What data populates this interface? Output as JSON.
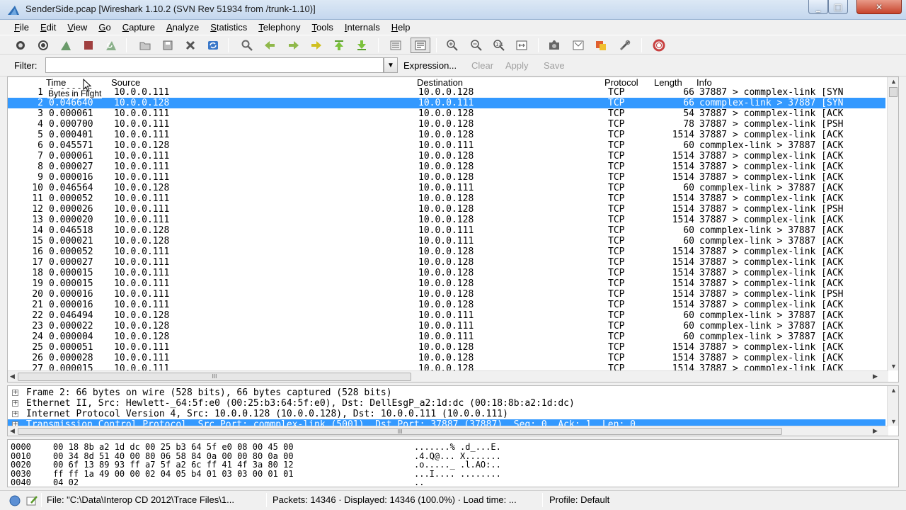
{
  "window": {
    "title": "SenderSide.pcap   [Wireshark 1.10.2  (SVN Rev 51934 from /trunk-1.10)]"
  },
  "menu": [
    "File",
    "Edit",
    "View",
    "Go",
    "Capture",
    "Analyze",
    "Statistics",
    "Telephony",
    "Tools",
    "Internals",
    "Help"
  ],
  "toolbar_icons": [
    "interface-list-icon",
    "capture-options-icon",
    "start-capture-icon",
    "stop-capture-icon",
    "restart-capture-icon",
    "open-file-icon",
    "save-file-icon",
    "close-file-icon",
    "reload-icon",
    "find-packet-icon",
    "go-back-icon",
    "go-forward-icon",
    "go-to-packet-icon",
    "go-first-icon",
    "go-last-icon",
    "colorize-icon",
    "auto-scroll-icon",
    "zoom-in-icon",
    "zoom-out-icon",
    "normal-size-icon",
    "resize-columns-icon",
    "capture-filters-icon",
    "display-filters-icon",
    "coloring-rules-icon",
    "preferences-icon",
    "help-icon"
  ],
  "filter": {
    "label": "Filter:",
    "value": "",
    "expression": "Expression...",
    "clear": "Clear",
    "apply": "Apply",
    "save": "Save"
  },
  "packet_list": {
    "columns": {
      "time": "Time",
      "source": "Source",
      "destination": "Destination",
      "protocol": "Protocol",
      "length": "Length",
      "info": "Info"
    },
    "tooltip": "Bytes in Flight",
    "selected_index": 1,
    "rows": [
      {
        "no": "1",
        "time": "0.000000",
        "src": "10.0.0.111",
        "dst": "10.0.0.128",
        "proto": "TCP",
        "len": "66",
        "info": "37887 > commplex-link [SYN"
      },
      {
        "no": "2",
        "time": "0.046640",
        "src": "10.0.0.128",
        "dst": "10.0.0.111",
        "proto": "TCP",
        "len": "66",
        "info": "commplex-link > 37887 [SYN"
      },
      {
        "no": "3",
        "time": "0.000061",
        "src": "10.0.0.111",
        "dst": "10.0.0.128",
        "proto": "TCP",
        "len": "54",
        "info": "37887 > commplex-link [ACK"
      },
      {
        "no": "4",
        "time": "0.000700",
        "src": "10.0.0.111",
        "dst": "10.0.0.128",
        "proto": "TCP",
        "len": "78",
        "info": "37887 > commplex-link [PSH"
      },
      {
        "no": "5",
        "time": "0.000401",
        "src": "10.0.0.111",
        "dst": "10.0.0.128",
        "proto": "TCP",
        "len": "1514",
        "info": "37887 > commplex-link [ACK"
      },
      {
        "no": "6",
        "time": "0.045571",
        "src": "10.0.0.128",
        "dst": "10.0.0.111",
        "proto": "TCP",
        "len": "60",
        "info": "commplex-link > 37887 [ACK"
      },
      {
        "no": "7",
        "time": "0.000061",
        "src": "10.0.0.111",
        "dst": "10.0.0.128",
        "proto": "TCP",
        "len": "1514",
        "info": "37887 > commplex-link [ACK"
      },
      {
        "no": "8",
        "time": "0.000027",
        "src": "10.0.0.111",
        "dst": "10.0.0.128",
        "proto": "TCP",
        "len": "1514",
        "info": "37887 > commplex-link [ACK"
      },
      {
        "no": "9",
        "time": "0.000016",
        "src": "10.0.0.111",
        "dst": "10.0.0.128",
        "proto": "TCP",
        "len": "1514",
        "info": "37887 > commplex-link [ACK"
      },
      {
        "no": "10",
        "time": "0.046564",
        "src": "10.0.0.128",
        "dst": "10.0.0.111",
        "proto": "TCP",
        "len": "60",
        "info": "commplex-link > 37887 [ACK"
      },
      {
        "no": "11",
        "time": "0.000052",
        "src": "10.0.0.111",
        "dst": "10.0.0.128",
        "proto": "TCP",
        "len": "1514",
        "info": "37887 > commplex-link [ACK"
      },
      {
        "no": "12",
        "time": "0.000026",
        "src": "10.0.0.111",
        "dst": "10.0.0.128",
        "proto": "TCP",
        "len": "1514",
        "info": "37887 > commplex-link [PSH"
      },
      {
        "no": "13",
        "time": "0.000020",
        "src": "10.0.0.111",
        "dst": "10.0.0.128",
        "proto": "TCP",
        "len": "1514",
        "info": "37887 > commplex-link [ACK"
      },
      {
        "no": "14",
        "time": "0.046518",
        "src": "10.0.0.128",
        "dst": "10.0.0.111",
        "proto": "TCP",
        "len": "60",
        "info": "commplex-link > 37887 [ACK"
      },
      {
        "no": "15",
        "time": "0.000021",
        "src": "10.0.0.128",
        "dst": "10.0.0.111",
        "proto": "TCP",
        "len": "60",
        "info": "commplex-link > 37887 [ACK"
      },
      {
        "no": "16",
        "time": "0.000052",
        "src": "10.0.0.111",
        "dst": "10.0.0.128",
        "proto": "TCP",
        "len": "1514",
        "info": "37887 > commplex-link [ACK"
      },
      {
        "no": "17",
        "time": "0.000027",
        "src": "10.0.0.111",
        "dst": "10.0.0.128",
        "proto": "TCP",
        "len": "1514",
        "info": "37887 > commplex-link [ACK"
      },
      {
        "no": "18",
        "time": "0.000015",
        "src": "10.0.0.111",
        "dst": "10.0.0.128",
        "proto": "TCP",
        "len": "1514",
        "info": "37887 > commplex-link [ACK"
      },
      {
        "no": "19",
        "time": "0.000015",
        "src": "10.0.0.111",
        "dst": "10.0.0.128",
        "proto": "TCP",
        "len": "1514",
        "info": "37887 > commplex-link [ACK"
      },
      {
        "no": "20",
        "time": "0.000016",
        "src": "10.0.0.111",
        "dst": "10.0.0.128",
        "proto": "TCP",
        "len": "1514",
        "info": "37887 > commplex-link [PSH"
      },
      {
        "no": "21",
        "time": "0.000016",
        "src": "10.0.0.111",
        "dst": "10.0.0.128",
        "proto": "TCP",
        "len": "1514",
        "info": "37887 > commplex-link [ACK"
      },
      {
        "no": "22",
        "time": "0.046494",
        "src": "10.0.0.128",
        "dst": "10.0.0.111",
        "proto": "TCP",
        "len": "60",
        "info": "commplex-link > 37887 [ACK"
      },
      {
        "no": "23",
        "time": "0.000022",
        "src": "10.0.0.128",
        "dst": "10.0.0.111",
        "proto": "TCP",
        "len": "60",
        "info": "commplex-link > 37887 [ACK"
      },
      {
        "no": "24",
        "time": "0.000004",
        "src": "10.0.0.128",
        "dst": "10.0.0.111",
        "proto": "TCP",
        "len": "60",
        "info": "commplex-link > 37887 [ACK"
      },
      {
        "no": "25",
        "time": "0.000051",
        "src": "10.0.0.111",
        "dst": "10.0.0.128",
        "proto": "TCP",
        "len": "1514",
        "info": "37887 > commplex-link [ACK"
      },
      {
        "no": "26",
        "time": "0.000028",
        "src": "10.0.0.111",
        "dst": "10.0.0.128",
        "proto": "TCP",
        "len": "1514",
        "info": "37887 > commplex-link [ACK"
      },
      {
        "no": "27",
        "time": "0.000015",
        "src": "10.0.0.111",
        "dst": "10.0.0.128",
        "proto": "TCP",
        "len": "1514",
        "info": "37887 > commplex-link [ACK"
      }
    ]
  },
  "details": [
    {
      "text": "Frame 2: 66 bytes on wire (528 bits), 66 bytes captured (528 bits)",
      "selected": false
    },
    {
      "text": "Ethernet II, Src: Hewlett-_64:5f:e0 (00:25:b3:64:5f:e0), Dst: DellEsgP_a2:1d:dc (00:18:8b:a2:1d:dc)",
      "selected": false
    },
    {
      "text": "Internet Protocol Version 4, Src: 10.0.0.128 (10.0.0.128), Dst: 10.0.0.111 (10.0.0.111)",
      "selected": false
    },
    {
      "text": "Transmission Control Protocol, Src Port: commplex-link (5001), Dst Port: 37887 (37887), Seq: 0, Ack: 1, Len: 0",
      "selected": true
    }
  ],
  "bytes": [
    {
      "offset": "0000",
      "hex": "00 18 8b a2 1d dc 00 25  b3 64 5f e0 08 00 45 00",
      "ascii": ".......% .d_...E."
    },
    {
      "offset": "0010",
      "hex": "00 34 8d 51 40 00 80 06  58 84 0a 00 00 80 0a 00",
      "ascii": ".4.Q@... X......."
    },
    {
      "offset": "0020",
      "hex": "00 6f 13 89 93 ff a7 5f  a2 6c ff 41 4f 3a 80 12",
      "ascii": ".o....._ .l.AO:.."
    },
    {
      "offset": "0030",
      "hex": "ff ff 1a 49 00 00 02 04  05 b4 01 03 03 00 01 01",
      "ascii": "...I.... ........"
    },
    {
      "offset": "0040",
      "hex": "04 02",
      "ascii": ".."
    }
  ],
  "status": {
    "file": "File: \"C:\\Data\\Interop CD 2012\\Trace Files\\1...",
    "packets": "Packets: 14346 · Displayed: 14346 (100.0%) · Load time: ...",
    "profile": "Profile: Default"
  },
  "colors": {
    "selection": "#3399ff",
    "accent": "#2f6fb6"
  }
}
